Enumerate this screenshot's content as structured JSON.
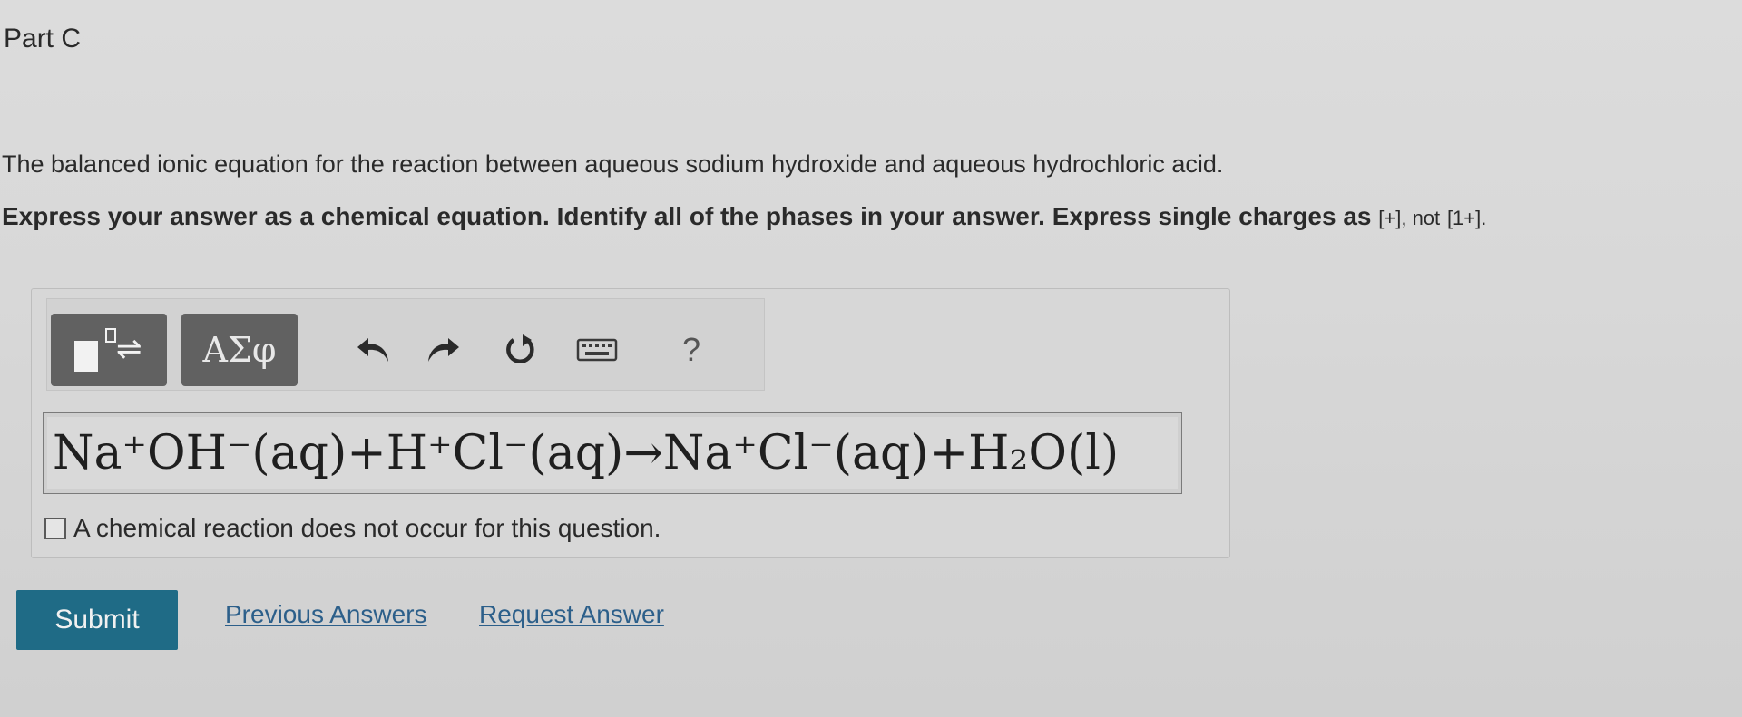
{
  "part": {
    "label": "Part C"
  },
  "question": {
    "text": "The balanced ionic equation for the reaction between aqueous sodium hydroxide and aqueous hydrochloric acid."
  },
  "instructions": {
    "bold_text": "Express your answer as a chemical equation. Identify all of the phases in your answer. Express single charges as",
    "plus_example": "[+]",
    "not_text": ", not",
    "one_plus_example": "[1+]",
    "end_text": "."
  },
  "toolbar": {
    "symbols_label": "ΑΣφ",
    "help_label": "?"
  },
  "equation": {
    "value": "Na⁺OH⁻(aq)+H⁺Cl⁻(aq)→Na⁺Cl⁻(aq)+H₂O(l)"
  },
  "no_reaction": {
    "label": "A chemical reaction does not occur for this question."
  },
  "actions": {
    "submit_label": "Submit",
    "previous_answers_label": "Previous Answers",
    "request_answer_label": "Request Answer"
  }
}
